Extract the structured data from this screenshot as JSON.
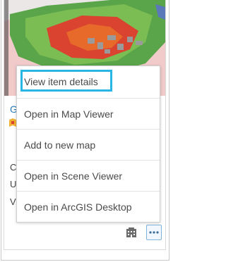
{
  "card": {
    "title_initial": "G",
    "meta_lines": [
      "C",
      "U",
      "Vi"
    ]
  },
  "menu": {
    "items": [
      {
        "label": "View item details"
      },
      {
        "label": "Open in Map Viewer"
      },
      {
        "label": "Add to new map"
      },
      {
        "label": "Open in Scene Viewer"
      },
      {
        "label": "Open in ArcGIS Desktop"
      }
    ]
  },
  "icons": {
    "footer": [
      "organization-building-icon",
      "more-options-icon"
    ],
    "badge": "item-type-badge-icon"
  },
  "colors": {
    "highlight": "#29b6e4",
    "link": "#2a7ab8",
    "menu_text": "#4a4a4a"
  }
}
